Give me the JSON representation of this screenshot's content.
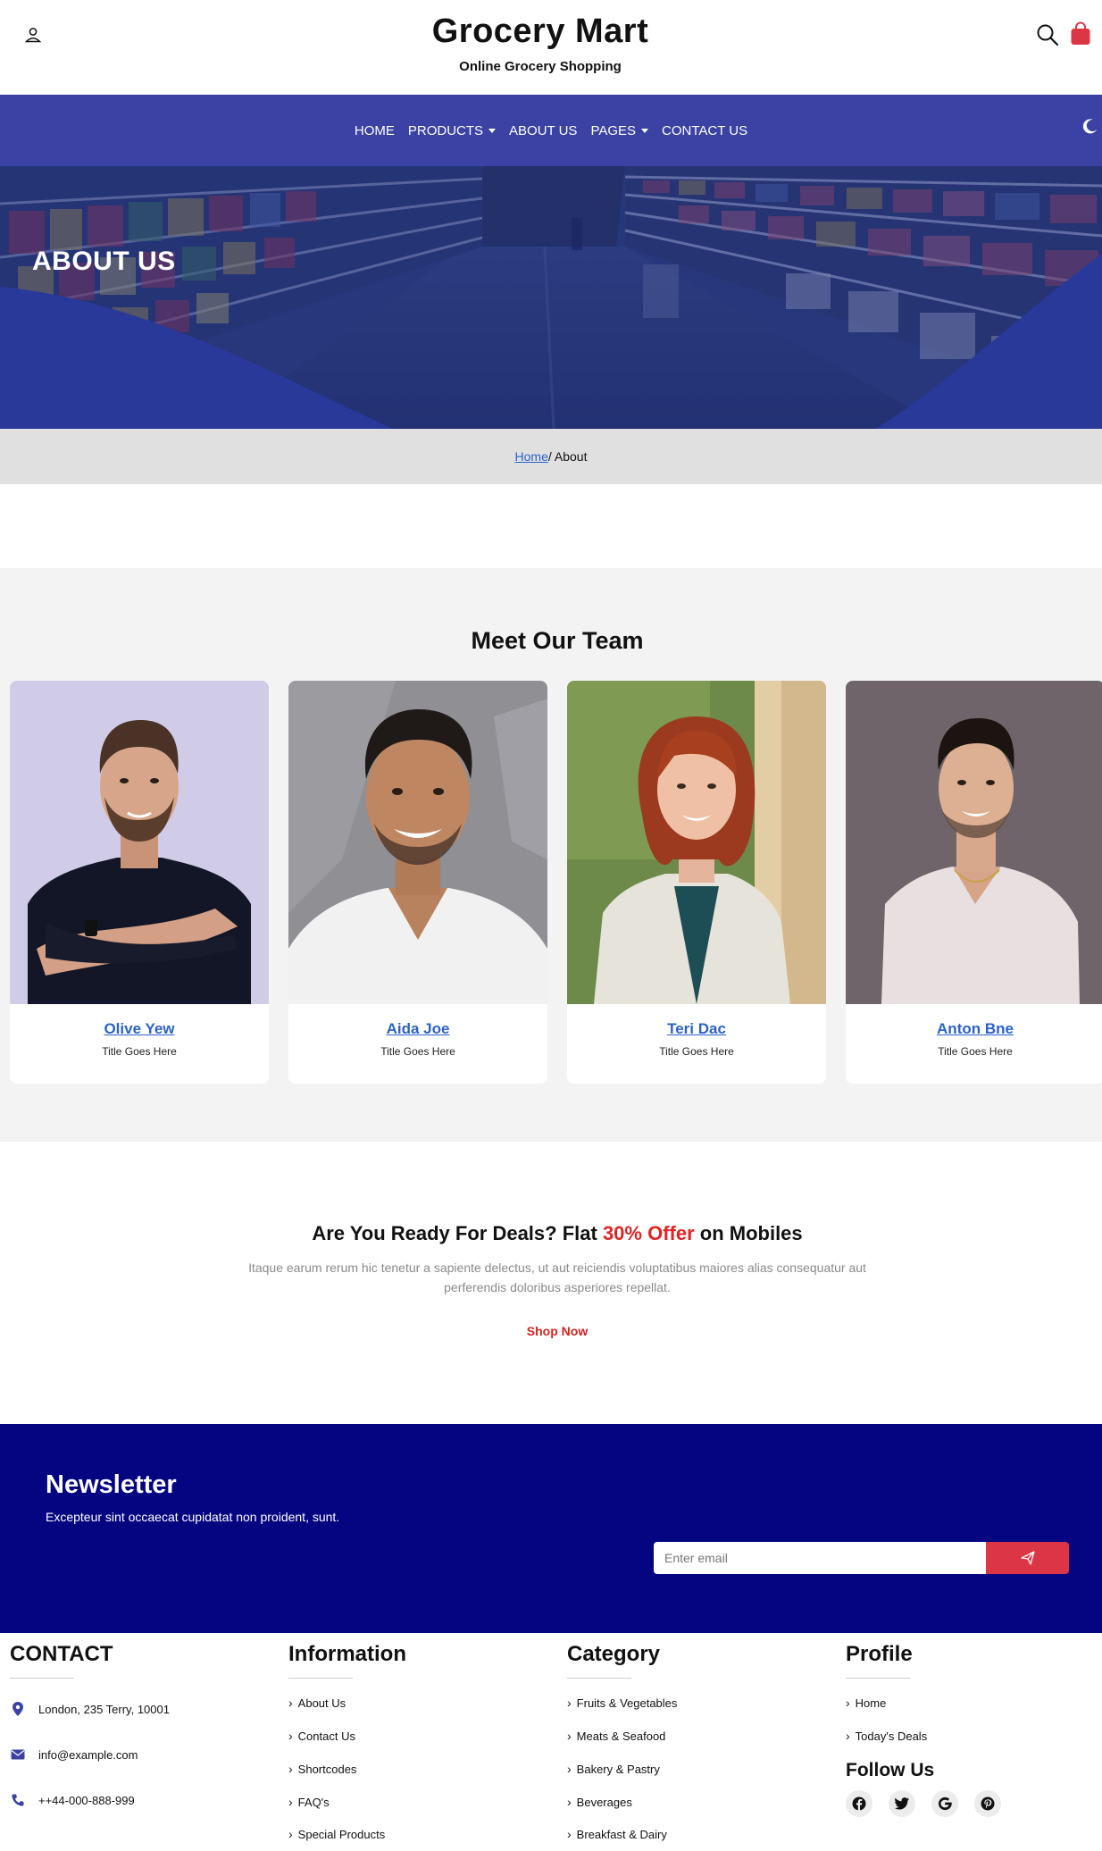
{
  "header": {
    "brand_title": "Grocery Mart",
    "brand_subtitle": "Online Grocery Shopping"
  },
  "nav": {
    "items": [
      {
        "label": "HOME",
        "dropdown": false
      },
      {
        "label": "PRODUCTS",
        "dropdown": true
      },
      {
        "label": "ABOUT US",
        "dropdown": false
      },
      {
        "label": "PAGES",
        "dropdown": true
      },
      {
        "label": "CONTACT US",
        "dropdown": false
      }
    ]
  },
  "hero": {
    "title": "ABOUT US"
  },
  "breadcrumb": {
    "home": "Home",
    "current": "/ About"
  },
  "team": {
    "heading": "Meet Our Team",
    "members": [
      {
        "name": "Olive Yew",
        "title": "Title Goes Here"
      },
      {
        "name": "Aida Joe",
        "title": "Title Goes Here"
      },
      {
        "name": "Teri Dac",
        "title": "Title Goes Here"
      },
      {
        "name": "Anton Bne",
        "title": "Title Goes Here"
      }
    ]
  },
  "deals": {
    "heading_prefix": "Are You Ready For Deals? Flat ",
    "heading_accent": "30% Offer",
    "heading_suffix": " on Mobiles",
    "text": "Itaque earum rerum hic tenetur a sapiente delectus, ut aut reiciendis voluptatibus maiores alias consequatur aut perferendis doloribus asperiores repellat.",
    "button": "Shop Now"
  },
  "newsletter": {
    "title": "Newsletter",
    "text": "Excepteur sint occaecat cupidatat non proident, sunt.",
    "placeholder": "Enter email"
  },
  "footer": {
    "contact": {
      "title": "CONTACT",
      "address": "London, 235 Terry, 10001",
      "email": "info@example.com",
      "phone": "++44-000-888-999"
    },
    "information": {
      "title": "Information",
      "links": [
        "About Us",
        "Contact Us",
        "Shortcodes",
        "FAQ's",
        "Special Products"
      ]
    },
    "category": {
      "title": "Category",
      "links": [
        "Fruits & Vegetables",
        "Meats & Seafood",
        "Bakery & Pastry",
        "Beverages",
        "Breakfast & Dairy"
      ]
    },
    "profile": {
      "title": "Profile",
      "links": [
        "Home",
        "Today's Deals"
      ],
      "follow_title": "Follow Us",
      "social": [
        "facebook-icon",
        "twitter-icon",
        "google-icon",
        "pinterest-icon"
      ]
    }
  },
  "colors": {
    "nav_bg": "#3b42a3",
    "newsletter_bg": "#050582",
    "accent_red": "#dc3545",
    "link_blue": "#2a62c8"
  }
}
